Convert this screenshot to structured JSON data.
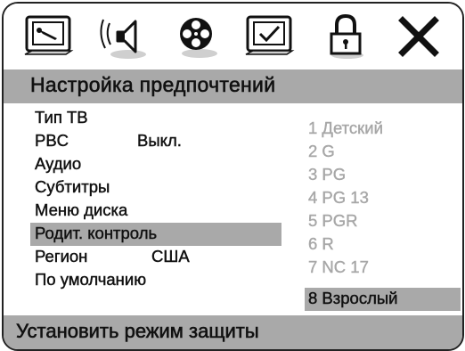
{
  "toolbar": {
    "icons": [
      {
        "name": "system-setup-icon"
      },
      {
        "name": "audio-setup-icon"
      },
      {
        "name": "video-setup-icon"
      },
      {
        "name": "preferences-icon"
      },
      {
        "name": "password-lock-icon"
      },
      {
        "name": "exit-icon"
      }
    ]
  },
  "title": "Настройка предпочтений",
  "menu": {
    "items": [
      {
        "label": "Тип ТВ",
        "value": ""
      },
      {
        "label": "PBC",
        "value": "Выкл."
      },
      {
        "label": "Аудио",
        "value": ""
      },
      {
        "label": "Субтитры",
        "value": ""
      },
      {
        "label": "Меню диска",
        "value": ""
      },
      {
        "label": "Родит. контроль",
        "value": ""
      },
      {
        "label": "Регион",
        "value": "США"
      },
      {
        "label": "По умолчанию",
        "value": ""
      }
    ],
    "selected_index": 5
  },
  "parental_levels": {
    "items": [
      "1 Детский",
      "2 G",
      "3 PG",
      "4 PG 13",
      "5 PGR",
      "6 R",
      "7 NC 17",
      "8 Взрослый"
    ],
    "selected_index": 7
  },
  "status": "Установить режим защиты",
  "colors": {
    "highlight": "#a9a9a9",
    "disabled_text": "#a7a7a7",
    "text": "#111111",
    "background": "#ffffff"
  }
}
